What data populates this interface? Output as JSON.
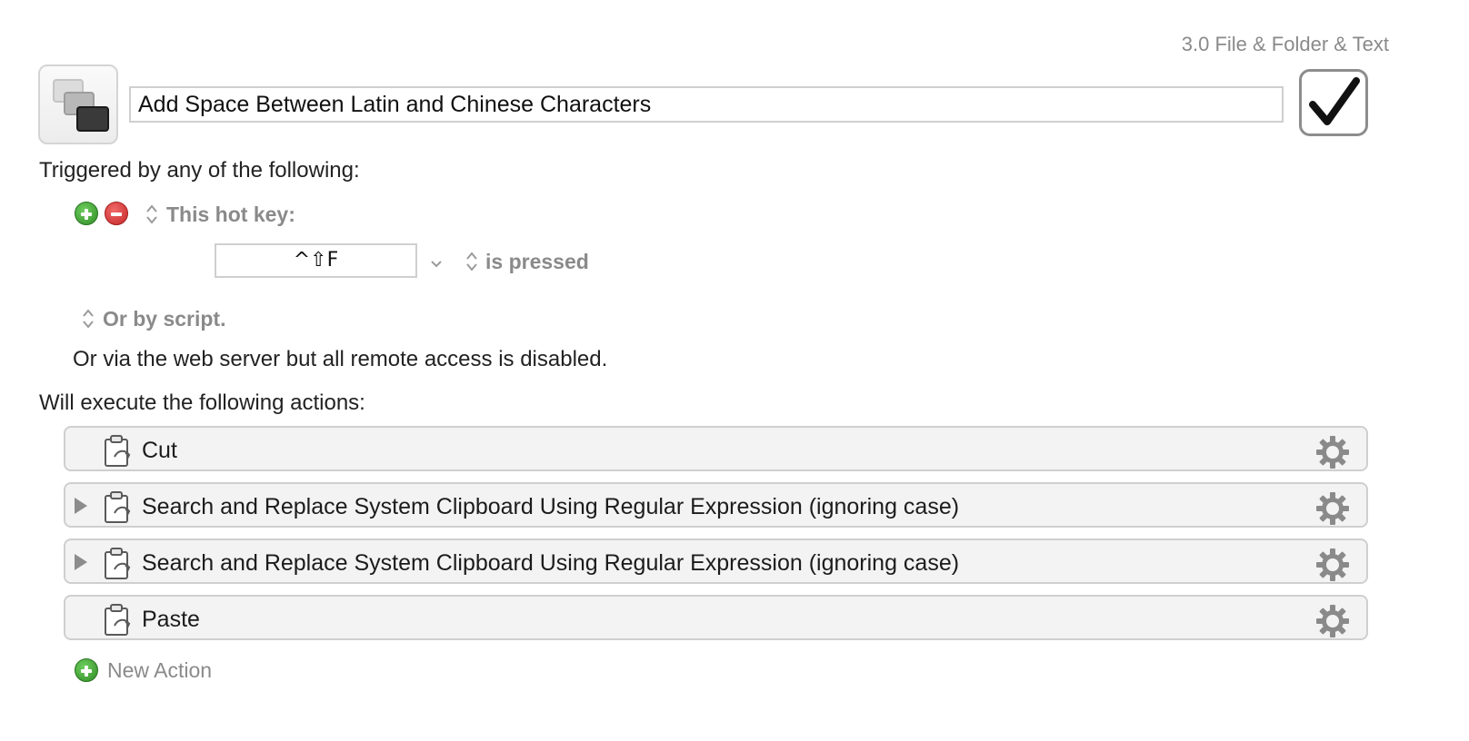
{
  "header": {
    "group_label": "3.0 File & Folder & Text",
    "macro_name": "Add Space Between Latin and Chinese Characters",
    "enabled_icon": "checkmark-icon"
  },
  "triggers": {
    "heading": "Triggered by any of the following:",
    "hotkey_trigger_label": "This hot key:",
    "hotkey_value": "^⇧F",
    "hotkey_condition": "is pressed",
    "script_trigger_label": "Or by script.",
    "web_server_note": "Or via the web server but all remote access is disabled."
  },
  "actions": {
    "heading": "Will execute the following actions:",
    "items": [
      {
        "label": "Cut",
        "expandable": false,
        "icon": "clipboard-icon"
      },
      {
        "label": "Search and Replace System Clipboard Using Regular Expression (ignoring case)",
        "expandable": true,
        "icon": "clipboard-icon"
      },
      {
        "label": "Search and Replace System Clipboard Using Regular Expression (ignoring case)",
        "expandable": true,
        "icon": "clipboard-icon"
      },
      {
        "label": "Paste",
        "expandable": false,
        "icon": "clipboard-icon"
      }
    ],
    "new_action_label": "New Action"
  },
  "colors": {
    "add_green": "#3d9a32",
    "remove_red": "#d33030",
    "secondary_text": "#8a8a8a"
  }
}
